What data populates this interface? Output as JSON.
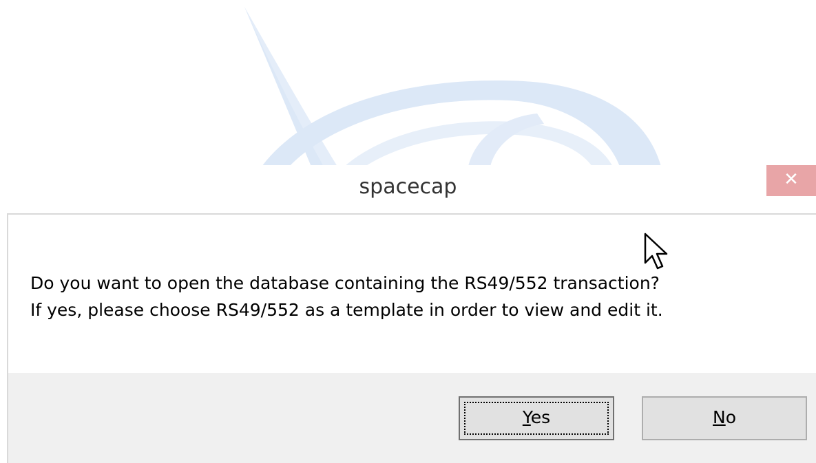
{
  "dialog": {
    "title": "spacecap",
    "close_label": "✕",
    "message_line1": "Do you want to open the database containing the RS49/552 transaction?",
    "message_line2": "If yes, please choose RS49/552 as a template in order to view and edit it."
  },
  "buttons": {
    "yes": {
      "mnemonic": "Y",
      "rest": "es"
    },
    "no": {
      "mnemonic": "N",
      "rest": "o"
    }
  },
  "colors": {
    "close_button": "#e8a5a7",
    "footer_bg": "#f0f0f0",
    "background_art": "#dce8f7"
  },
  "icons": {
    "cursor": "arrow-pointer-icon",
    "background": "globe-swoosh-logo"
  }
}
